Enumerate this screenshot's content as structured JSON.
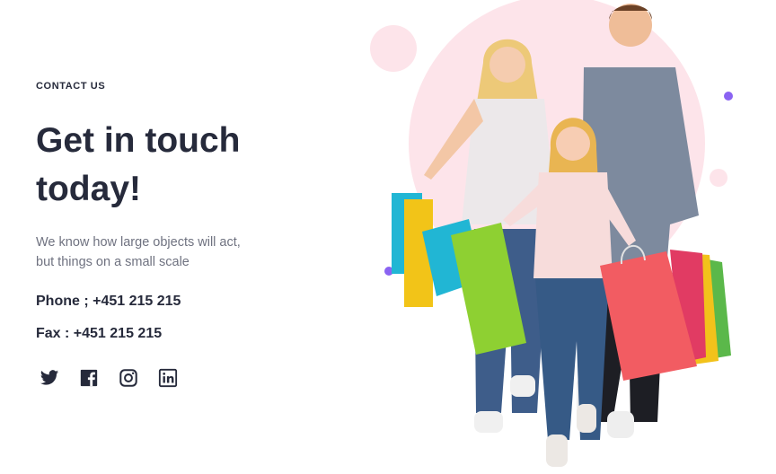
{
  "contact": {
    "eyebrow": "CONTACT US",
    "headline_line1": "Get in touch",
    "headline_line2": "today!",
    "description_line1": "We know how large objects will act,",
    "description_line2": "but things on a small scale",
    "phone": "Phone ; +451 215 215",
    "fax": "Fax : +451 215 215"
  },
  "socials": [
    {
      "icon": "twitter-icon"
    },
    {
      "icon": "facebook-icon"
    },
    {
      "icon": "instagram-icon"
    },
    {
      "icon": "linkedin-icon"
    }
  ],
  "colors": {
    "heading": "#262a3b",
    "body_text": "#6f7280",
    "pink_circle": "#fde4ea",
    "accent_purple": "#8a63f2"
  }
}
